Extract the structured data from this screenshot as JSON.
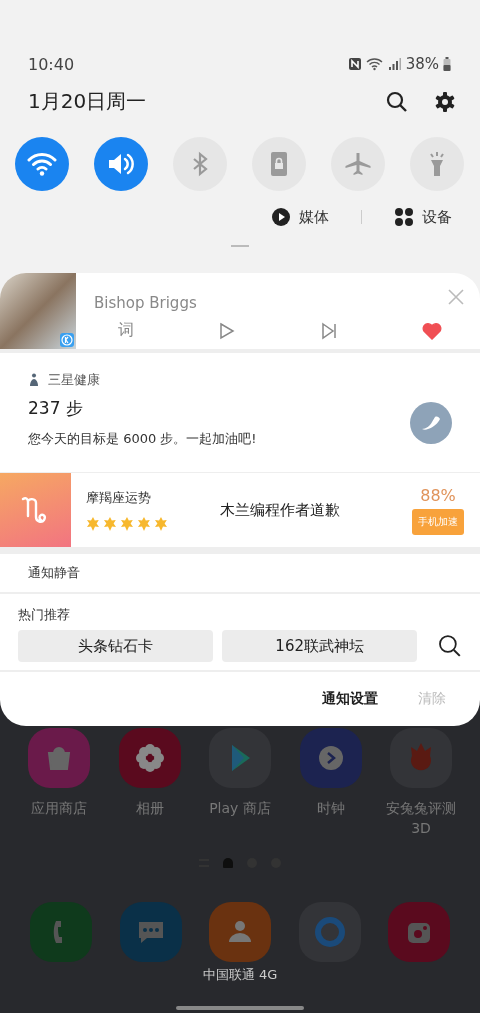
{
  "status_bar": {
    "time": "10:40",
    "battery": "38%"
  },
  "header": {
    "date": "1月20日周一"
  },
  "quick_tiles": [
    {
      "kind": "wifi",
      "on": true
    },
    {
      "kind": "sound",
      "on": true
    },
    {
      "kind": "bluetooth",
      "on": false
    },
    {
      "kind": "lock",
      "on": false
    },
    {
      "kind": "airplane",
      "on": false
    },
    {
      "kind": "flashlight",
      "on": false
    }
  ],
  "panel_links": [
    {
      "kind": "media",
      "label": "媒体"
    },
    {
      "kind": "devices",
      "label": "设备"
    }
  ],
  "music": {
    "artist": "Bishop Briggs",
    "lyrics": "词",
    "liked": true
  },
  "health": {
    "app": "三星健康",
    "steps": "237 步",
    "message": "您今天的目标是 6000 步。一起加油吧!"
  },
  "horoscope": {
    "title": "摩羯座运势",
    "stars": 5,
    "headline": "木兰编程作者道歉",
    "percent": "88%",
    "button": "手机加速"
  },
  "silent": {
    "label": "通知静音"
  },
  "hot": {
    "title": "热门推荐",
    "items": [
      "头条钻石卡",
      "162联武神坛"
    ]
  },
  "footer": {
    "settings": "通知设置",
    "clear": "清除"
  },
  "home_apps": [
    {
      "kind": "bag",
      "label": "应用商店",
      "color": "#6a1a4a"
    },
    {
      "kind": "flower",
      "label": "相册",
      "color": "#5a0a1e"
    },
    {
      "kind": "play",
      "label": "Play 商店",
      "color": "#333438"
    },
    {
      "kind": "clock",
      "label": "时钟",
      "color": "#1c2350"
    },
    {
      "kind": "fire",
      "label": "安兔兔评测\n3D",
      "color": "#333438"
    }
  ],
  "page_dots": [
    {
      "kind": "list",
      "selected": false
    },
    {
      "kind": "home",
      "selected": true
    },
    {
      "kind": "dot",
      "selected": false
    },
    {
      "kind": "dot",
      "selected": false
    }
  ],
  "dock": [
    {
      "kind": "phone",
      "color": "#0f3a1c"
    },
    {
      "kind": "chat",
      "color": "#0a3048"
    },
    {
      "kind": "person",
      "color": "#6a3210"
    },
    {
      "kind": "ring",
      "color": "#333438"
    },
    {
      "kind": "camera",
      "color": "#5a0a1e"
    }
  ],
  "carrier": "中国联通 4G"
}
